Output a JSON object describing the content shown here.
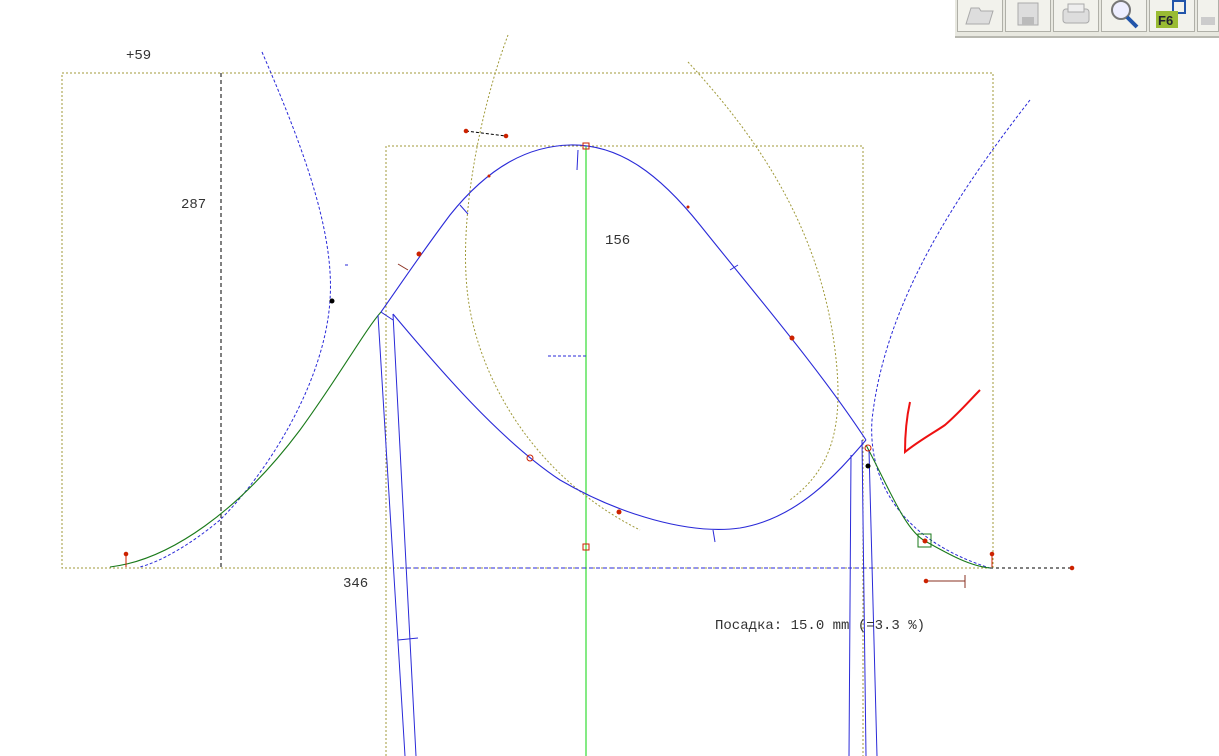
{
  "toolbar": {
    "buttons": [
      {
        "icon": "open-folder-icon"
      },
      {
        "icon": "save-icon"
      },
      {
        "icon": "print-icon"
      },
      {
        "icon": "zoom-magnifier-icon"
      },
      {
        "icon": "f6-transform-icon",
        "label": "F6"
      },
      {
        "icon": "extra-icon"
      }
    ]
  },
  "drawing": {
    "dim_top": "+59",
    "dim_height": "287",
    "dim_center": "156",
    "dim_width": "346",
    "ease_text": "Посадка: 15.0 mm (=3.3 %)"
  },
  "colors": {
    "contour": "#2a2ad8",
    "construction": "#a09a3a",
    "seam_green": "#1a7a1a",
    "axis_green": "#33dd33",
    "marker_red": "#cc2200",
    "annotation_red": "#ee1111"
  }
}
